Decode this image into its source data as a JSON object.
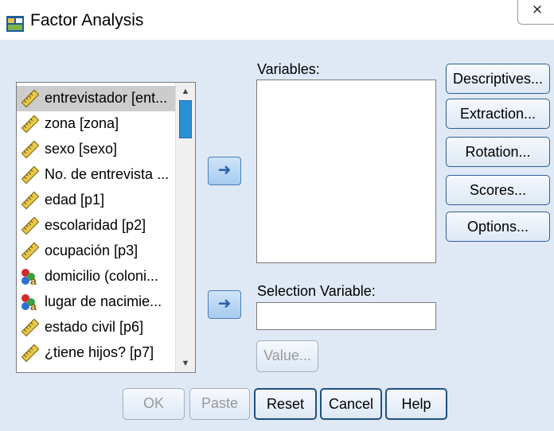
{
  "window": {
    "title": "Factor Analysis",
    "close_glyph": "⨯",
    "icon": "spss-dialog-icon"
  },
  "source_list": {
    "items": [
      {
        "label": "entrevistador [ent...",
        "type": "scale",
        "selected": true
      },
      {
        "label": "zona [zona]",
        "type": "scale"
      },
      {
        "label": "sexo [sexo]",
        "type": "scale"
      },
      {
        "label": "No. de entrevista ...",
        "type": "scale"
      },
      {
        "label": "edad [p1]",
        "type": "scale"
      },
      {
        "label": "escolaridad [p2]",
        "type": "scale"
      },
      {
        "label": "ocupación [p3]",
        "type": "scale"
      },
      {
        "label": "domicilio (coloni...",
        "type": "nominal-string"
      },
      {
        "label": "lugar de nacimie...",
        "type": "nominal-string"
      },
      {
        "label": "estado civil [p6]",
        "type": "scale"
      },
      {
        "label": "¿tiene hijos? [p7]",
        "type": "scale"
      }
    ]
  },
  "variables": {
    "label": "Variables:"
  },
  "selection": {
    "label": "Selection Variable:",
    "value": "",
    "value_button": "Value..."
  },
  "side_buttons": {
    "descriptives": "Descriptives...",
    "extraction": "Extraction...",
    "rotation": "Rotation...",
    "scores": "Scores...",
    "options": "Options..."
  },
  "bottom_buttons": {
    "ok": "OK",
    "paste": "Paste",
    "reset": "Reset",
    "cancel": "Cancel",
    "help": "Help"
  },
  "arrow_glyph": "➜",
  "colors": {
    "dialog_bg": "#dfe9f5",
    "accent": "#2a90d6",
    "button_border": "#2c5e93"
  }
}
